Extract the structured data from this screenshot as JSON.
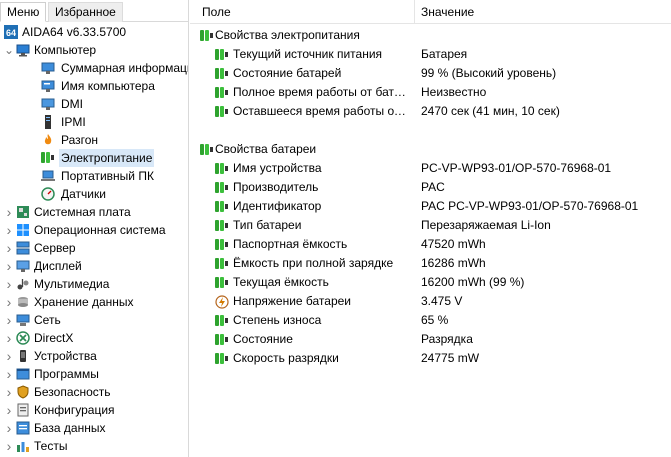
{
  "tabs": {
    "menu": "Меню",
    "favorites": "Избранное"
  },
  "tree": [
    {
      "label": "AIDA64 v6.33.5700",
      "icon": "aida64-logo-icon",
      "level": 0,
      "arrow": "",
      "selected": false
    },
    {
      "label": "Компьютер",
      "icon": "computer-icon",
      "level": 0,
      "arrow": "down",
      "selected": false
    },
    {
      "label": "Суммарная информация",
      "icon": "summary-monitor-icon",
      "level": 1,
      "arrow": "",
      "selected": false
    },
    {
      "label": "Имя компьютера",
      "icon": "computer-name-icon",
      "level": 1,
      "arrow": "",
      "selected": false
    },
    {
      "label": "DMI",
      "icon": "dmi-icon",
      "level": 1,
      "arrow": "",
      "selected": false
    },
    {
      "label": "IPMI",
      "icon": "ipmi-icon",
      "level": 1,
      "arrow": "",
      "selected": false
    },
    {
      "label": "Разгон",
      "icon": "overclock-flame-icon",
      "level": 1,
      "arrow": "",
      "selected": false
    },
    {
      "label": "Электропитание",
      "icon": "battery-icon",
      "level": 1,
      "arrow": "",
      "selected": true
    },
    {
      "label": "Портативный ПК",
      "icon": "laptop-icon",
      "level": 1,
      "arrow": "",
      "selected": false
    },
    {
      "label": "Датчики",
      "icon": "sensor-gauge-icon",
      "level": 1,
      "arrow": "",
      "selected": false
    },
    {
      "label": "Системная плата",
      "icon": "motherboard-icon",
      "level": 0,
      "arrow": "right",
      "selected": false
    },
    {
      "label": "Операционная система",
      "icon": "windows-icon",
      "level": 0,
      "arrow": "right",
      "selected": false
    },
    {
      "label": "Сервер",
      "icon": "server-icon",
      "level": 0,
      "arrow": "right",
      "selected": false
    },
    {
      "label": "Дисплей",
      "icon": "display-icon",
      "level": 0,
      "arrow": "right",
      "selected": false
    },
    {
      "label": "Мультимедиа",
      "icon": "multimedia-icon",
      "level": 0,
      "arrow": "right",
      "selected": false
    },
    {
      "label": "Хранение данных",
      "icon": "storage-icon",
      "level": 0,
      "arrow": "right",
      "selected": false
    },
    {
      "label": "Сеть",
      "icon": "network-icon",
      "level": 0,
      "arrow": "right",
      "selected": false
    },
    {
      "label": "DirectX",
      "icon": "directx-icon",
      "level": 0,
      "arrow": "right",
      "selected": false
    },
    {
      "label": "Устройства",
      "icon": "devices-icon",
      "level": 0,
      "arrow": "right",
      "selected": false
    },
    {
      "label": "Программы",
      "icon": "programs-icon",
      "level": 0,
      "arrow": "right",
      "selected": false
    },
    {
      "label": "Безопасность",
      "icon": "security-shield-icon",
      "level": 0,
      "arrow": "right",
      "selected": false
    },
    {
      "label": "Конфигурация",
      "icon": "configuration-icon",
      "level": 0,
      "arrow": "right",
      "selected": false
    },
    {
      "label": "База данных",
      "icon": "database-icon",
      "level": 0,
      "arrow": "right",
      "selected": false
    },
    {
      "label": "Тесты",
      "icon": "tests-icon",
      "level": 0,
      "arrow": "right",
      "selected": false
    }
  ],
  "columns": {
    "field": "Поле",
    "value": "Значение"
  },
  "groups": [
    {
      "title": "Свойства электропитания",
      "icon": "battery-icon",
      "rows": [
        {
          "field": "Текущий источник питания",
          "value": "Батарея",
          "icon": "battery-icon"
        },
        {
          "field": "Состояние батарей",
          "value": "99 % (Высокий уровень)",
          "icon": "battery-icon"
        },
        {
          "field": "Полное время работы от батареи",
          "value": "Неизвестно",
          "icon": "battery-icon"
        },
        {
          "field": "Оставшееся время работы от батареи",
          "value": "2470 сек (41 мин, 10 сек)",
          "icon": "battery-icon"
        }
      ]
    },
    {
      "title": "Свойства батареи",
      "icon": "battery-icon",
      "rows": [
        {
          "field": "Имя устройства",
          "value": "PC-VP-WP93-01/OP-570-76968-01",
          "icon": "battery-icon"
        },
        {
          "field": "Производитель",
          "value": "PAC",
          "icon": "battery-icon"
        },
        {
          "field": "Идентификатор",
          "value": "PAC  PC-VP-WP93-01/OP-570-76968-01",
          "icon": "battery-icon"
        },
        {
          "field": "Тип батареи",
          "value": "Перезаряжаемая Li-Ion",
          "icon": "battery-icon"
        },
        {
          "field": "Паспортная ёмкость",
          "value": "47520 mWh",
          "icon": "battery-icon"
        },
        {
          "field": "Ёмкость при полной зарядке",
          "value": "16286 mWh",
          "icon": "battery-icon"
        },
        {
          "field": "Текущая ёмкость",
          "value": "16200 mWh  (99 %)",
          "icon": "battery-icon"
        },
        {
          "field": "Напряжение батареи",
          "value": "3.475 V",
          "icon": "voltage-bolt-icon"
        },
        {
          "field": "Степень износа",
          "value": "65 %",
          "icon": "battery-icon"
        },
        {
          "field": "Состояние",
          "value": "Разрядка",
          "icon": "battery-icon"
        },
        {
          "field": "Скорость разрядки",
          "value": "24775 mW",
          "icon": "battery-icon"
        }
      ]
    }
  ]
}
